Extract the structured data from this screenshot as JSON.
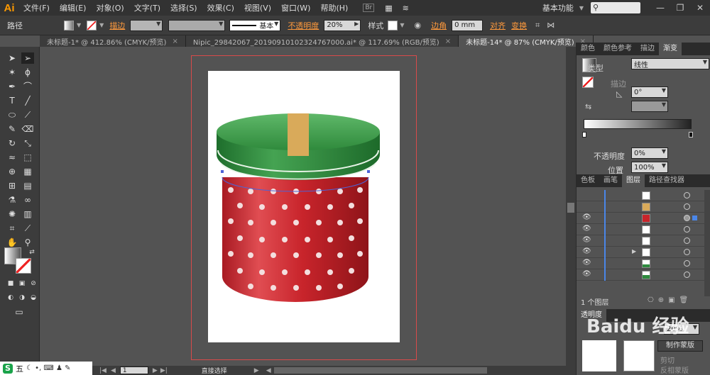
{
  "app": {
    "logo": "Ai"
  },
  "menu": [
    "文件(F)",
    "编辑(E)",
    "对象(O)",
    "文字(T)",
    "选择(S)",
    "效果(C)",
    "视图(V)",
    "窗口(W)",
    "帮助(H)"
  ],
  "menu_icons": {
    "bridge": "Br",
    "arrange": "▦",
    "gpu": "≋"
  },
  "workspace": {
    "label": "基本功能",
    "search_placeholder": ""
  },
  "window_buttons": {
    "minimize": "—",
    "restore": "❐",
    "close": "✕"
  },
  "control": {
    "object_type": "路径",
    "stroke_label": "描边",
    "stroke_weight_label": "基本",
    "opacity_label": "不透明度",
    "opacity_value": "20%",
    "style_label": "样式",
    "corner_label": "边角",
    "corner_value": "0 mm",
    "align_label": "对齐",
    "transform_label": "变换"
  },
  "tabs": [
    {
      "label": "未标题-1* @ 412.86% (CMYK/预览)",
      "close": "×"
    },
    {
      "label": "Nipic_29842067_20190910102324767000.ai* @ 117.69% (RGB/预览)",
      "close": "×"
    },
    {
      "label": "未标题-14* @ 87% (CMYK/预览)",
      "close": "×"
    }
  ],
  "gradient_panel": {
    "tabs": [
      "颜色",
      "颜色参考",
      "描边",
      "渐变"
    ],
    "type_label": "类型",
    "type_value": "线性",
    "stroke_label": "描边",
    "angle_value": "0°",
    "opacity_label": "不透明度",
    "opacity_value": "0%",
    "position_label": "位置",
    "position_value": "100%"
  },
  "layers_panel": {
    "tabs": [
      "色板",
      "画笔",
      "图层",
      "路径查找器"
    ],
    "footer": "1 个图层",
    "eye": "👁",
    "expand_arrow": "▶"
  },
  "bottom_panel": {
    "tab": "透明度",
    "opacity_value": "20%",
    "make_mask": "制作蒙版",
    "clip": "剪切",
    "invert_mask": "反相蒙版"
  },
  "status": {
    "zoom": "1",
    "tool": "直接选择"
  },
  "watermark": "Baidu 经验",
  "ime": {
    "logo": "S",
    "mode": "五",
    "icons": "☾ •, ⌨ ♟ ✎"
  },
  "colors": {
    "accent": "#ff9a3c",
    "lid": "#2e8b3e",
    "body": "#c8242b",
    "ribbon": "#d9aa5a"
  }
}
